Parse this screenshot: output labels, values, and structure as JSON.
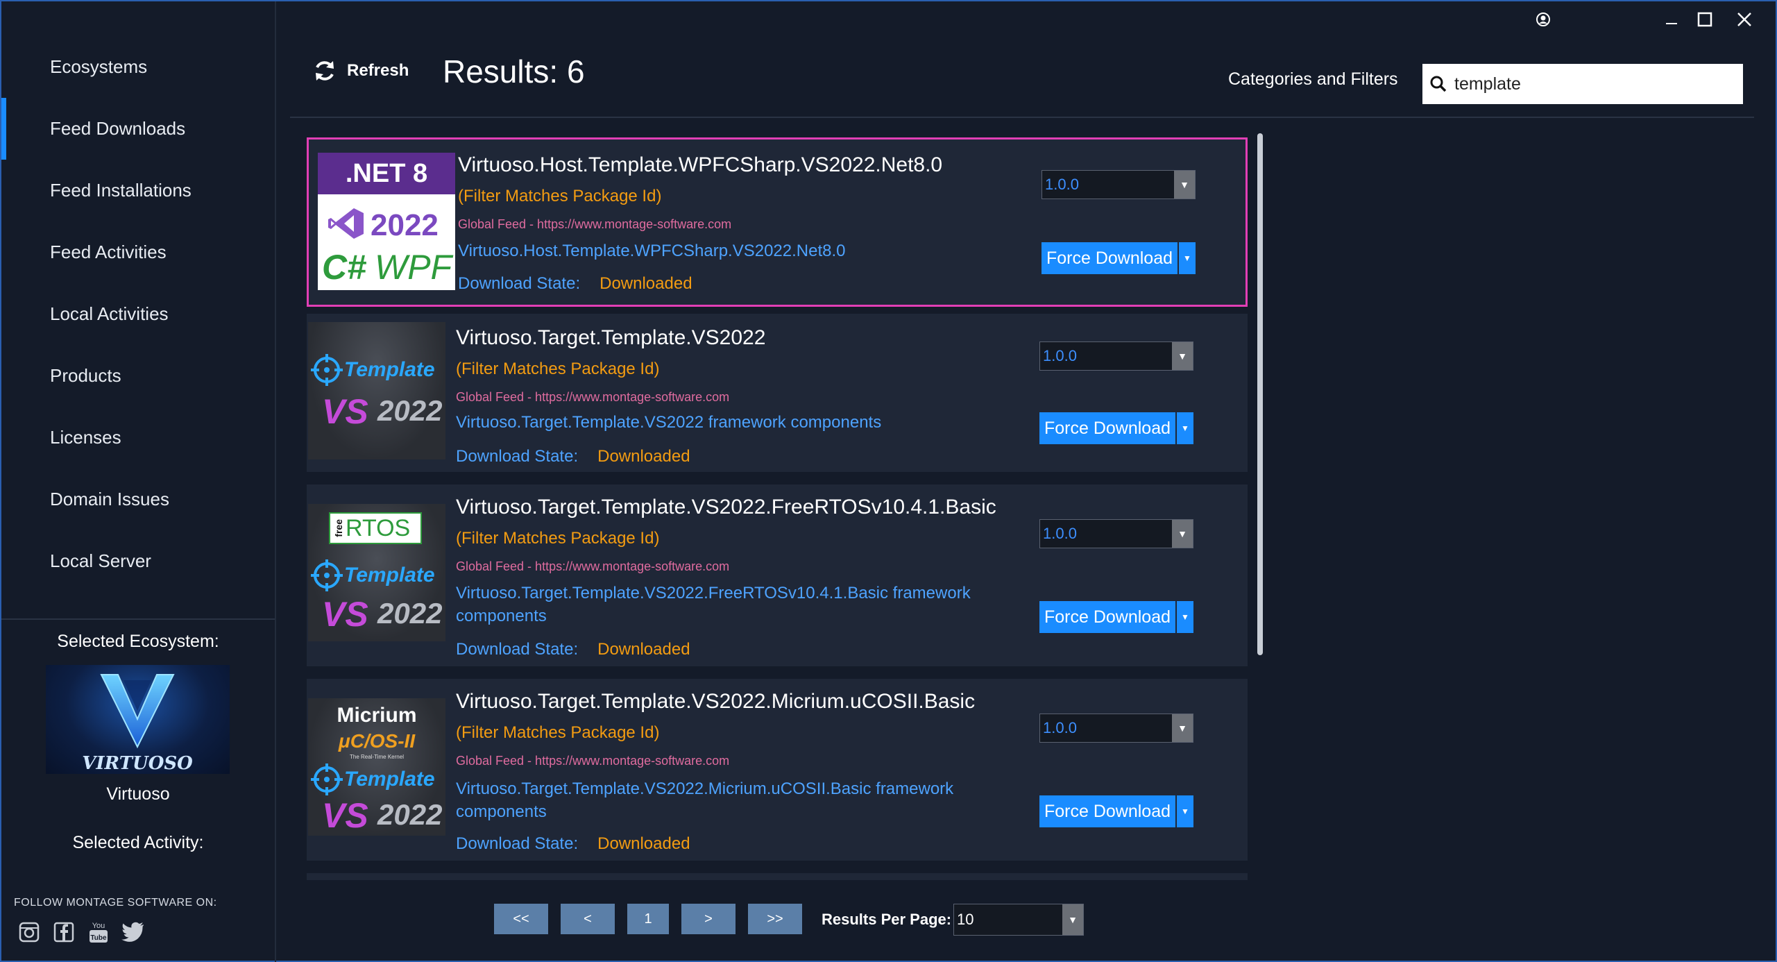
{
  "sidebar": {
    "items": [
      {
        "label": "Ecosystems"
      },
      {
        "label": "Feed Downloads"
      },
      {
        "label": "Feed Installations"
      },
      {
        "label": "Feed Activities"
      },
      {
        "label": "Local Activities"
      },
      {
        "label": "Products"
      },
      {
        "label": "Licenses"
      },
      {
        "label": "Domain Issues"
      },
      {
        "label": "Local Server"
      }
    ],
    "active_item": "Feed Downloads",
    "selected_ecosystem_label": "Selected Ecosystem:",
    "ecosystem_name": "Virtuoso",
    "ecosystem_logo_text": "VIRTUOSO",
    "selected_activity_label": "Selected Activity:",
    "follow_text": "FOLLOW MONTAGE SOFTWARE ON:",
    "social_icons": [
      "instagram-icon",
      "facebook-icon",
      "youtube-icon",
      "twitter-icon"
    ]
  },
  "header": {
    "refresh_label": "Refresh",
    "results_text": "Results: 6",
    "categories_label": "Categories and Filters",
    "search_value": "template"
  },
  "results": [
    {
      "title": "Virtuoso.Host.Template.WPFCSharp.VS2022.Net8.0",
      "filter": "(Filter Matches Package Id)",
      "feed": "Global Feed - https://www.montage-software.com",
      "description": "Virtuoso.Host.Template.WPFCSharp.VS2022.Net8.0",
      "state_label": "Download State:",
      "state_value": "Downloaded",
      "version": "1.0.0",
      "button_label": "Force Download",
      "thumb": {
        "line1": ".NET 8",
        "line2": "2022",
        "line3": "C#",
        "line4": "WPF"
      }
    },
    {
      "title": "Virtuoso.Target.Template.VS2022",
      "filter": "(Filter Matches Package Id)",
      "feed": "Global Feed - https://www.montage-software.com",
      "description": "Virtuoso.Target.Template.VS2022 framework components",
      "state_label": "Download State:",
      "state_value": "Downloaded",
      "version": "1.0.0",
      "button_label": "Force Download",
      "thumb": {
        "line1": "Template",
        "line2": "VS",
        "line3": "2022"
      }
    },
    {
      "title": "Virtuoso.Target.Template.VS2022.FreeRTOSv10.4.1.Basic",
      "filter": "(Filter Matches Package Id)",
      "feed": "Global Feed - https://www.montage-software.com",
      "description": "Virtuoso.Target.Template.VS2022.FreeRTOSv10.4.1.Basic framework components",
      "state_label": "Download State:",
      "state_value": "Downloaded",
      "version": "1.0.0",
      "button_label": "Force Download",
      "thumb": {
        "badge_small": "free",
        "badge": "RTOS",
        "line1": "Template",
        "line2": "VS",
        "line3": "2022"
      }
    },
    {
      "title": "Virtuoso.Target.Template.VS2022.Micrium.uCOSII.Basic",
      "filter": "(Filter Matches Package Id)",
      "feed": "Global Feed - https://www.montage-software.com",
      "description": "Virtuoso.Target.Template.VS2022.Micrium.uCOSII.Basic framework components",
      "state_label": "Download State:",
      "state_value": "Downloaded",
      "version": "1.0.0",
      "button_label": "Force Download",
      "thumb": {
        "brand": "Micrium",
        "product": "μC/OS-II",
        "tagline": "The Real-Time Kernel",
        "line1": "Template",
        "line2": "VS",
        "line3": "2022"
      }
    }
  ],
  "pagination": {
    "first": "<<",
    "prev": "<",
    "page": "1",
    "next": ">",
    "last": ">>",
    "per_page_label": "Results Per Page:",
    "per_page_value": "10"
  },
  "colors": {
    "background": "#141b29",
    "card": "#1f2737",
    "accent": "#1a8cff",
    "link": "#4ea3ff",
    "orange": "#f39c12",
    "feed_pink": "#e06c9f",
    "selection": "#e13fb5"
  }
}
